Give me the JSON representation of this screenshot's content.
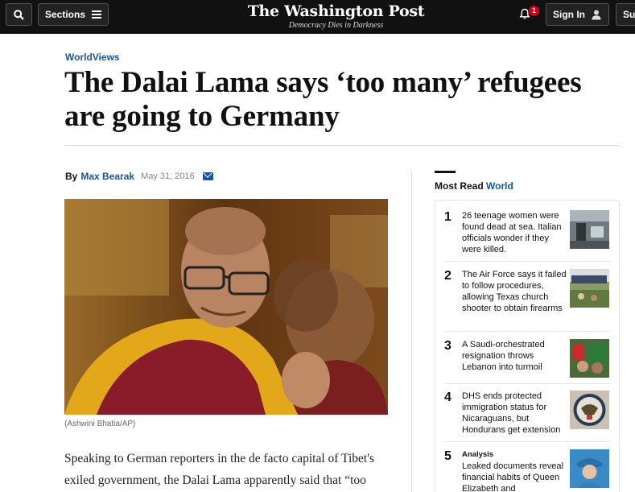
{
  "nav": {
    "search_icon": "search-icon",
    "sections_label": "Sections",
    "logo_title": "The Washington Post",
    "logo_tagline": "Democracy Dies in Darkness",
    "notification_count": "1",
    "signin_label": "Sign In",
    "subscribe_label": "Subscribe"
  },
  "article": {
    "kicker": "WorldViews",
    "headline": "The Dalai Lama says ‘too many’ refugees are going to Germany",
    "byline_prefix": "By",
    "author": "Max Bearak",
    "date": "May 31, 2016",
    "photo_caption": "(Ashwini Bhatia/AP)",
    "body": "Speaking to German reporters in the de facto capital of Tibet's exiled government, the Dalai Lama apparently said that “too many” refugees are now living in Germany."
  },
  "most_read": {
    "title_prefix": "Most Read",
    "title_section": "World",
    "items": [
      {
        "rank": "1",
        "label": "",
        "text": "26 teenage women were found dead at sea. Italian officials wonder if they were killed."
      },
      {
        "rank": "2",
        "label": "",
        "text": "The Air Force says it failed to follow procedures, allowing Texas church shooter to obtain firearms"
      },
      {
        "rank": "3",
        "label": "",
        "text": "A Saudi-orchestrated resignation throws Lebanon into turmoil"
      },
      {
        "rank": "4",
        "label": "",
        "text": "DHS ends protected immigration status for Nicaraguans, but Hondurans get extension"
      },
      {
        "rank": "5",
        "label": "Analysis",
        "text": "Leaked documents reveal financial habits of Queen Elizabeth and"
      }
    ]
  },
  "colors": {
    "brand_blue": "#1955a5",
    "nav_bg": "#111111",
    "badge_red": "#d0021b"
  }
}
